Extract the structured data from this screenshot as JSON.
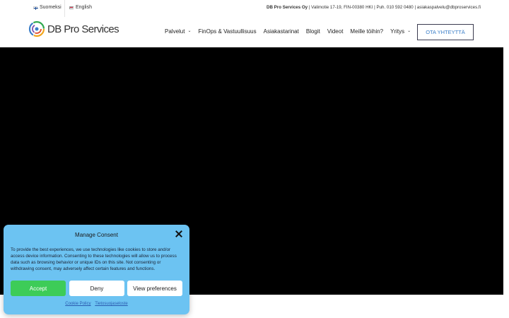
{
  "topbar": {
    "languages": [
      {
        "label": "Suomeksi"
      },
      {
        "label": "English"
      }
    ],
    "contact": {
      "company": "DB Pro Services Oy",
      "details": " | Valimotie 17-19, FIN-00380 HKI | Puh. 010 592 0480  |  asiakaspalvelu@dbproservices.fi"
    }
  },
  "header": {
    "logo_text": "DB Pro Services",
    "nav": [
      {
        "label": "Palvelut",
        "dropdown": true
      },
      {
        "label": "FinOps & Vastuullisuus",
        "dropdown": false
      },
      {
        "label": "Asiakastarinat",
        "dropdown": false
      },
      {
        "label": "Blogit",
        "dropdown": false
      },
      {
        "label": "Videot",
        "dropdown": false
      },
      {
        "label": "Meille töihin?",
        "dropdown": false
      },
      {
        "label": "Yritys",
        "dropdown": true
      }
    ],
    "cta_label": "OTA YHTEYTTÄ"
  },
  "consent": {
    "title": "Manage Consent",
    "text": "To provide the best experiences, we use technologies like cookies to store and/or access device information. Consenting to these technologies will allow us to process data such as browsing behavior or unique IDs on this site. Not consenting or withdrawing consent, may adversely affect certain features and functions.",
    "accept_label": "Accept",
    "deny_label": "Deny",
    "preferences_label": "View preferences",
    "cookie_policy_label": "Cookie Policy",
    "privacy_label": "Tietosuojaseloste"
  },
  "colors": {
    "consent_bg": "#6cc3f2",
    "accept_bg": "#3dcc58",
    "cta_text": "#3a7ec8",
    "video_bg": "#000000"
  }
}
